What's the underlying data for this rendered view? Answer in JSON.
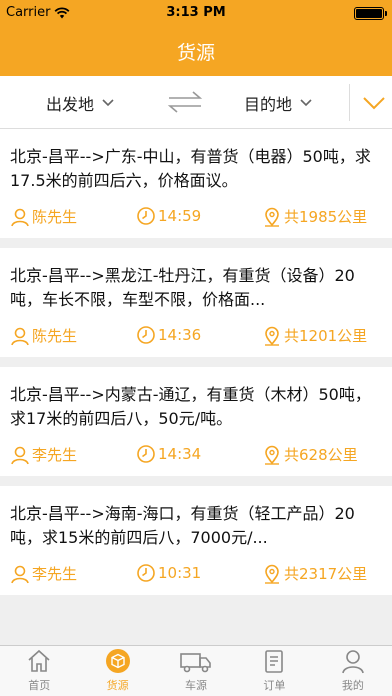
{
  "status": {
    "carrier": "Carrier",
    "time": "3:13 PM"
  },
  "header": {
    "title": "货源"
  },
  "filter": {
    "from_label": "出发地",
    "to_label": "目的地"
  },
  "cards": [
    {
      "description": "北京-昌平-->广东-中山，有普货（电器）50吨，求17.5米的前四后六，价格面议。",
      "contact": "陈先生",
      "time": "14:59",
      "distance": "共1985公里"
    },
    {
      "description": "北京-昌平-->黑龙江-牡丹江，有重货（设备）20吨，车长不限，车型不限，价格面...",
      "contact": "陈先生",
      "time": "14:36",
      "distance": "共1201公里"
    },
    {
      "description": "北京-昌平-->内蒙古-通辽，有重货（木材）50吨，求17米的前四后八，50元/吨。",
      "contact": "李先生",
      "time": "14:34",
      "distance": "共628公里"
    },
    {
      "description": "北京-昌平-->海南-海口，有重货（轻工产品）20吨，求15米的前四后八，7000元/...",
      "contact": "李先生",
      "time": "10:31",
      "distance": "共2317公里"
    }
  ],
  "tabs": [
    {
      "label": "首页",
      "icon": "home-icon"
    },
    {
      "label": "货源",
      "icon": "cargo-icon",
      "active": true
    },
    {
      "label": "车源",
      "icon": "truck-icon"
    },
    {
      "label": "订单",
      "icon": "order-icon"
    },
    {
      "label": "我的",
      "icon": "profile-icon"
    }
  ],
  "colors": {
    "accent": "#f5a623"
  }
}
